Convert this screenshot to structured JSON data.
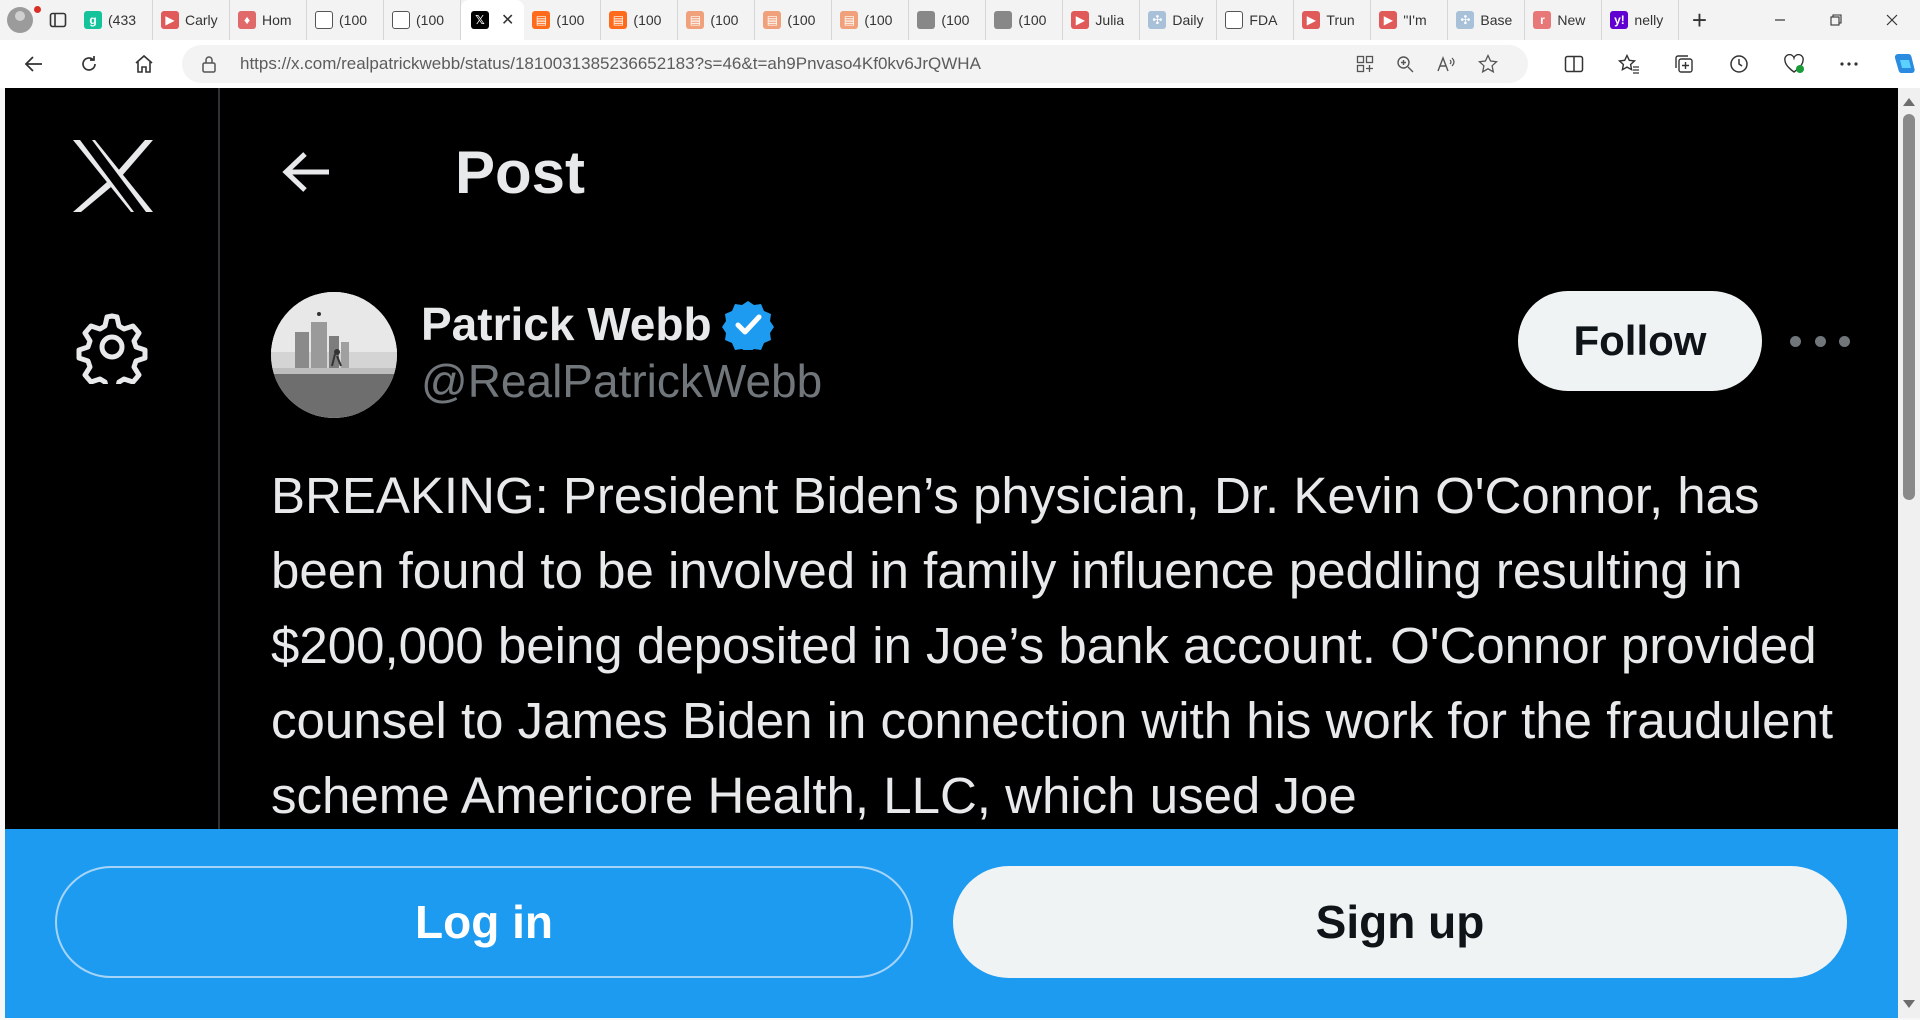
{
  "browser": {
    "tabs": [
      {
        "title": "(433",
        "favicon_color": "#15c39a",
        "favicon_glyph": "g",
        "icon": "grammarly-icon"
      },
      {
        "title": "Carly",
        "favicon_color": "#e05a5a",
        "favicon_glyph": "▶",
        "icon": "youtube-icon"
      },
      {
        "title": "Hom",
        "favicon_color": "#e06a6a",
        "favicon_glyph": "♦",
        "icon": "site-icon"
      },
      {
        "title": "(100",
        "favicon_color": "#ffffff",
        "favicon_glyph": "",
        "icon": "document-icon"
      },
      {
        "title": "(100",
        "favicon_color": "#ffffff",
        "favicon_glyph": "",
        "icon": "document-icon"
      },
      {
        "title": "",
        "favicon_color": "#000000",
        "favicon_glyph": "𝕏",
        "icon": "x-icon",
        "active": true
      },
      {
        "title": "(100",
        "favicon_color": "#ff6b1a",
        "favicon_glyph": "▤",
        "icon": "substack-icon"
      },
      {
        "title": "(100",
        "favicon_color": "#ff6b1a",
        "favicon_glyph": "▤",
        "icon": "substack-icon"
      },
      {
        "title": "(100",
        "favicon_color": "#f0a07a",
        "favicon_glyph": "▤",
        "icon": "substack-icon"
      },
      {
        "title": "(100",
        "favicon_color": "#f0a07a",
        "favicon_glyph": "▤",
        "icon": "substack-icon"
      },
      {
        "title": "(100",
        "favicon_color": "#f0a07a",
        "favicon_glyph": "▤",
        "icon": "substack-icon"
      },
      {
        "title": "(100",
        "favicon_color": "#888888",
        "favicon_glyph": "",
        "icon": "image-icon"
      },
      {
        "title": "(100",
        "favicon_color": "#888888",
        "favicon_glyph": "",
        "icon": "image-icon"
      },
      {
        "title": "Julia",
        "favicon_color": "#e05a5a",
        "favicon_glyph": "▶",
        "icon": "youtube-icon"
      },
      {
        "title": "Daily",
        "favicon_color": "#a8c0d8",
        "favicon_glyph": "✣",
        "icon": "site-icon"
      },
      {
        "title": "FDA",
        "favicon_color": "#ffffff",
        "favicon_glyph": "",
        "icon": "document-icon"
      },
      {
        "title": "Trun",
        "favicon_color": "#e05a5a",
        "favicon_glyph": "▶",
        "icon": "youtube-icon"
      },
      {
        "title": "\"I'm",
        "favicon_color": "#e05a5a",
        "favicon_glyph": "▶",
        "icon": "youtube-icon"
      },
      {
        "title": "Base",
        "favicon_color": "#a8c0d8",
        "favicon_glyph": "✣",
        "icon": "site-icon"
      },
      {
        "title": "New",
        "favicon_color": "#e87878",
        "favicon_glyph": "r",
        "icon": "site-icon"
      },
      {
        "title": "nelly",
        "favicon_color": "#6001d2",
        "favicon_glyph": "y!",
        "icon": "yahoo-icon"
      }
    ],
    "url": "https://x.com/realpatrickwebb/status/1810031385236652183?s=46&t=ah9Pnvaso4Kf0kv6JrQWHA"
  },
  "page": {
    "header_title": "Post",
    "author": {
      "name": "Patrick Webb",
      "handle": "@RealPatrickWebb",
      "verified": true
    },
    "follow_label": "Follow",
    "tweet_text": "BREAKING: President Biden’s physician, Dr. Kevin O'Connor, has been found to be involved in family influence peddling resulting in $200,000 being deposited in Joe’s bank account. O'Connor provided counsel to James Biden in connection with his work for the fraudulent scheme Americore Health, LLC, which used Joe",
    "login_label": "Log in",
    "signup_label": "Sign up"
  },
  "colors": {
    "background": "#000000",
    "text_primary": "#e7e9ea",
    "text_secondary": "#71767b",
    "accent_blue": "#1d9bf0",
    "button_light": "#eff3f4"
  }
}
